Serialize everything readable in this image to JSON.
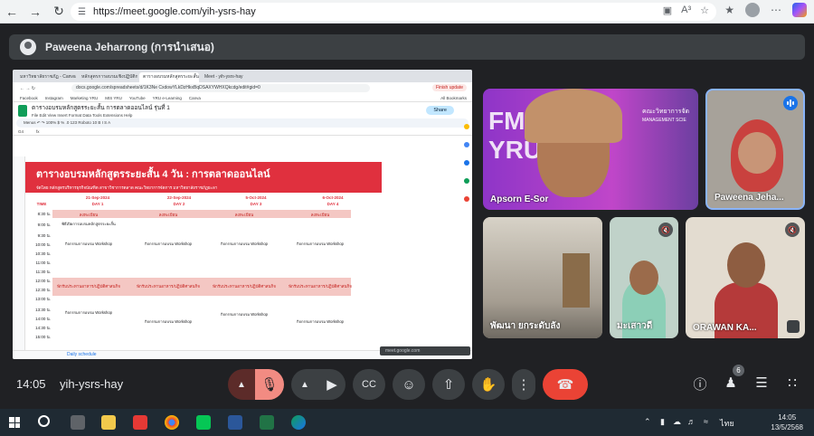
{
  "browser": {
    "url": "https://meet.google.com/yih-ysrs-hay",
    "omnibox_icons": [
      "A³",
      "☆"
    ]
  },
  "presenter": {
    "label": "Paweena Jeharrong (การนำเสนอ)"
  },
  "shared_screen": {
    "tabs": [
      "มหาวิทยาลัยราชภัฏ - Canva",
      "หลักสูตรการอบรมเชิงปฏิบัติการ",
      "ตารางอบรมหลักสูตรระยะสั้น",
      "Meet - yih-ysrs-hay"
    ],
    "address": "docs.google.com/spreadsheets/d/1K3Ne CxdowYLkDzHkxBqDSAXYWHXQkcdg/edit#gid=0",
    "update_label": "Finish update",
    "bookmarks": [
      "Facebook",
      "Instagram",
      "Marketing YRU",
      "MIS YRU",
      "YouTube",
      "YRU e-Learning",
      "Canva",
      "All Bookmarks"
    ],
    "doc_title": "ตารางอบรมหลักสูตรระยะสั้น การตลาดออนไลน์ รุ่นที่ 1",
    "menus": "File  Edit  View  Insert  Format  Data  Tools  Extensions  Help",
    "share_label": "Share",
    "toolbar": "Menus   ↶ ↷   100%   $  %  .0  123   Roboto   10   B  I  S  A",
    "cell_ref": "G4",
    "banner_title": "ตารางอบรมหลักสูตรระยะสั้น 4 วัน : การตลาดออนไลน์",
    "banner_sub": "จัดโดย  หลักสูตรบริหารธุรกิจบัณฑิต สาขาวิชาการตลาด คณะวิทยาการจัดการ มหาวิทยาลัยราชภัฏยะลา",
    "days": [
      {
        "date": "21-Sep-2024",
        "day": "DAY 1"
      },
      {
        "date": "22-Sep-2024",
        "day": "DAY 2"
      },
      {
        "date": "5-Oct-2024",
        "day": "DAY 3"
      },
      {
        "date": "6-Oct-2024",
        "day": "DAY 4"
      }
    ],
    "time_header": "TIME",
    "times": [
      "8:30 น.",
      "9:00 น.",
      "9:30 น.",
      "10:00 น.",
      "10:30 น.",
      "11:00 น.",
      "11:30 น.",
      "12:00 น.",
      "12:30 น.",
      "13:00 น.",
      "13:30 น.",
      "14:00 น.",
      "14:30 น.",
      "15:00 น."
    ],
    "register": "ลงทะเบียน",
    "lunch": "พักรับประทานอาหาร/ปฏิบัติศาสนกิจ",
    "day1_morning": "พิธีเปิดการอบรมหลักสูตรระยะสั้น",
    "workshop": "กิจกรรมการอบรม Workshop",
    "sheet_tab": "Daily schedule",
    "meet_chip": "meet.google.com"
  },
  "participants": [
    {
      "name": "Apsorn E-Sor",
      "state": "muted-off"
    },
    {
      "name": "Paweena Jeha...",
      "state": "speaking"
    },
    {
      "name": "พัฒนา ยกระดับลัง",
      "state": "none"
    },
    {
      "name": "มะเสาวดี",
      "state": "muted"
    },
    {
      "name": "ORAWAN KA...",
      "state": "muted"
    }
  ],
  "tile_overlay_text": {
    "fms": "FMS",
    "yru": "YRU",
    "faculty_th": "คณะวิทยาการจัด",
    "faculty_en": "MANAGEMENT SCIE"
  },
  "meeting": {
    "time": "14:05",
    "code": "yih-ysrs-hay",
    "people_count": "6"
  },
  "taskbar": {
    "time": "14:05",
    "date": "13/5/2568",
    "lang": "ไทย"
  },
  "colors": {
    "meet_bg": "#202124",
    "end_call": "#ea4335",
    "mic_muted": "#f28b82",
    "banner_red": "#e0303e"
  }
}
